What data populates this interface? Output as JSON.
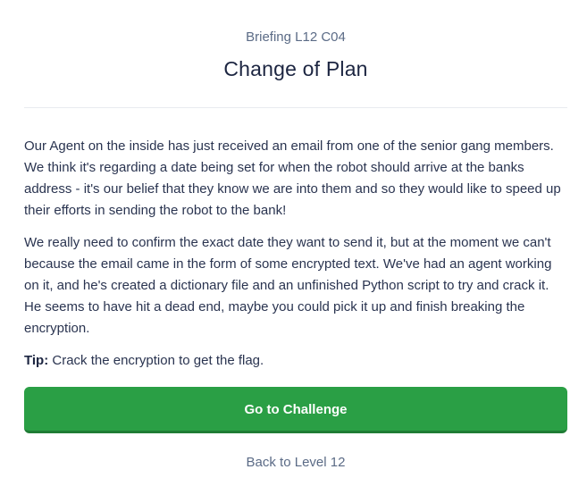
{
  "header": {
    "subtitle": "Briefing L12 C04",
    "title": "Change of Plan"
  },
  "content": {
    "paragraphs": [
      "Our Agent on the inside has just received an email from one of the senior gang members. We think it's regarding a date being set for when the robot should arrive at the banks address - it's our belief that they know we are into them and so they would like to speed up their efforts in sending the robot to the bank!",
      "We really need to confirm the exact date they want to send it, but at the moment we can't because the email came in the form of some encrypted text. We've had an agent working on it, and he's created a dictionary file and an unfinished Python script to try and crack it. He seems to have hit a dead end, maybe you could pick it up and finish breaking the encryption."
    ],
    "tip_label": "Tip:",
    "tip_text": "Crack the encryption to get the flag."
  },
  "actions": {
    "primary_label": "Go to Challenge",
    "back_label": "Back to Level 12"
  },
  "colors": {
    "primary": "#2a9f45",
    "muted_text": "#5b6b86",
    "title_text": "#1c2541"
  }
}
